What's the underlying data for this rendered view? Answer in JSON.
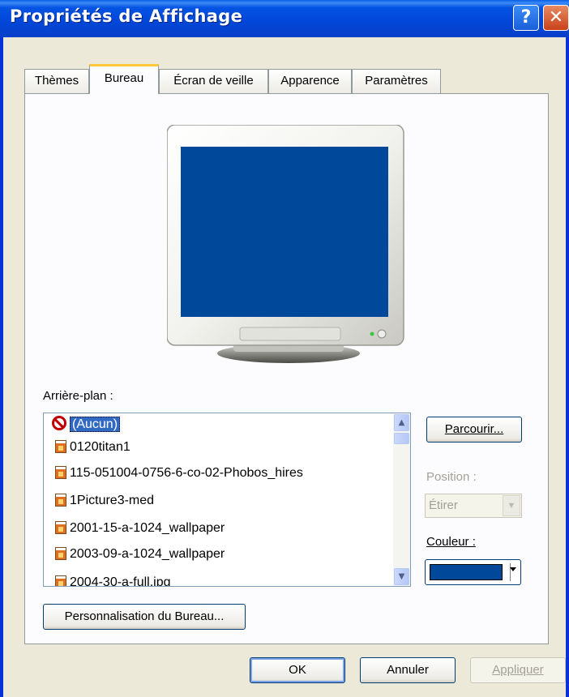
{
  "window": {
    "title": "Propriétés de Affichage",
    "help_label": "?",
    "close_label": "✕"
  },
  "tabs": [
    {
      "label": "Thèmes",
      "active": false
    },
    {
      "label": "Bureau",
      "active": true
    },
    {
      "label": "Écran de veille",
      "active": false
    },
    {
      "label": "Apparence",
      "active": false
    },
    {
      "label": "Paramètres",
      "active": false
    }
  ],
  "background": {
    "label": "Arrière-plan :",
    "items": [
      {
        "label": "(Aucun)",
        "icon": "none-icon",
        "selected": true
      },
      {
        "label": "0120titan1",
        "icon": "image-file-icon"
      },
      {
        "label": "115-051004-0756-6-co-02-Phobos_hires",
        "icon": "image-file-icon"
      },
      {
        "label": "1Picture3-med",
        "icon": "image-file-icon"
      },
      {
        "label": "2001-15-a-1024_wallpaper",
        "icon": "image-file-icon"
      },
      {
        "label": "2003-09-a-1024_wallpaper",
        "icon": "image-file-icon"
      },
      {
        "label": "2004-30-a-full.jpg",
        "icon": "image-file-icon"
      }
    ]
  },
  "side": {
    "browse_label": "Parcourir...",
    "position_label": "Position :",
    "position_value": "Étirer",
    "color_label": "Couleur :",
    "color_value": "#00489a"
  },
  "customize_label": "Personnalisation du Bureau...",
  "footer": {
    "ok_label": "OK",
    "cancel_label": "Annuler",
    "apply_label": "Appliquer"
  },
  "colors": {
    "titlebar": "#0054e3",
    "desktop_preview": "#00489a",
    "tab_highlight": "#ffc83c"
  }
}
